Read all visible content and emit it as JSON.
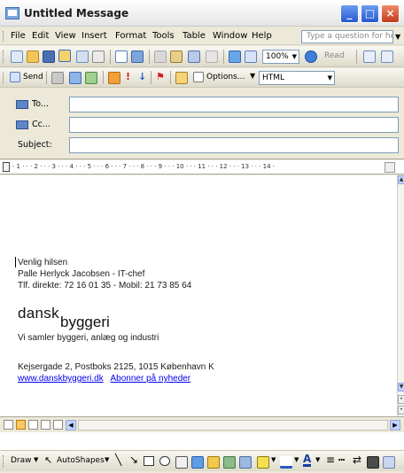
{
  "window": {
    "title": "Untitled Message"
  },
  "menubar": {
    "items": [
      "File",
      "Edit",
      "View",
      "Insert",
      "Format",
      "Tools",
      "Table",
      "Window",
      "Help"
    ],
    "help_placeholder": "Type a question for help"
  },
  "toolbar_standard": {
    "zoom": "100%",
    "read_label": "Read"
  },
  "toolbar_email": {
    "send_label": "Send",
    "options_label": "Options...",
    "format_value": "HTML"
  },
  "header": {
    "to_label": "To...",
    "cc_label": "Cc...",
    "subject_label": "Subject:",
    "to_value": "",
    "cc_value": "",
    "subject_value": ""
  },
  "ruler": {
    "scale": "· 1 · · · 2 · · · 3 · · · 4 · · · 5 · · · 6 · · · 7 · · · 8 · · · 9 · · · 10 · · · 11 · · · 12 · · · 13 · · · 14 ·"
  },
  "body": {
    "signature_lines": [
      "Venlig hilsen",
      "Palle Herlyck Jacobsen - IT-chef",
      "Tlf. direkte: 72 16 01 35 - Mobil: 21 73 85 64"
    ],
    "logo_word1": "dansk",
    "logo_word2": "byggeri",
    "tagline": "Vi samler byggeri, anlæg og industri",
    "address": "Kejsergade 2, Postboks 2125, 1015 København K",
    "website": "www.danskbyggeri.dk",
    "newsletter": "Abonner på nyheder"
  },
  "drawbar": {
    "draw_label": "Draw",
    "autoshapes_label": "AutoShapes"
  },
  "colors": {
    "chrome": "#ece9d8",
    "link": "#0000ee",
    "xp_blue": "#2659cf",
    "xp_red": "#c43a1c"
  }
}
